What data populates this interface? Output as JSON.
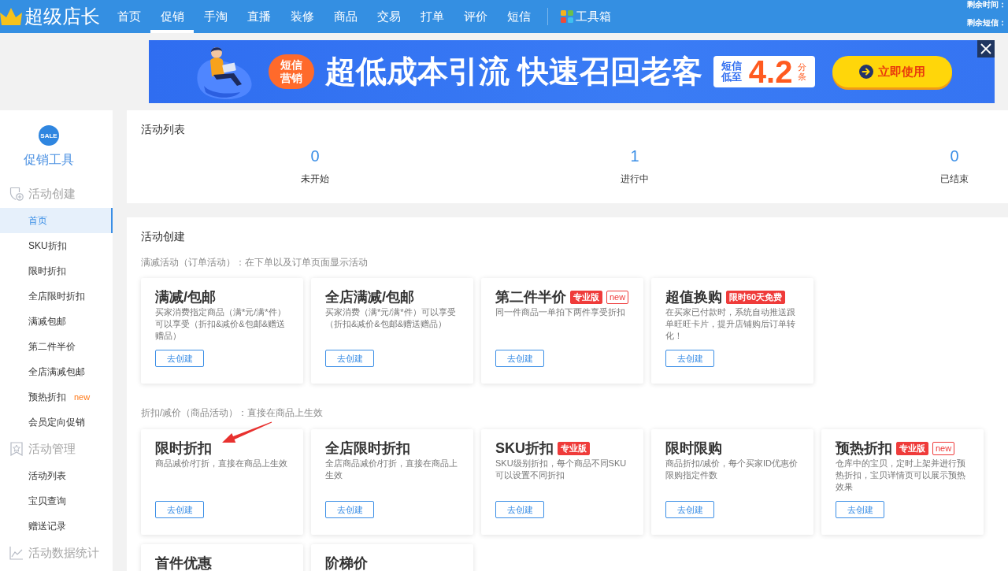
{
  "header": {
    "logo": "超级店长",
    "nav": [
      {
        "label": "首页",
        "selected": false
      },
      {
        "label": "促销",
        "selected": true
      },
      {
        "label": "手淘",
        "selected": false
      },
      {
        "label": "直播",
        "selected": false
      },
      {
        "label": "装修",
        "selected": false
      },
      {
        "label": "商品",
        "selected": false
      },
      {
        "label": "交易",
        "selected": false
      },
      {
        "label": "打单",
        "selected": false
      },
      {
        "label": "评价",
        "selected": false
      },
      {
        "label": "短信",
        "selected": false
      }
    ],
    "toolbox": "工具箱",
    "info": [
      "剩余时间：",
      "剩余短信："
    ]
  },
  "banner": {
    "badge": "短信营销",
    "headline": "超低成本引流 快速召回老客",
    "price_label": "短信低至",
    "price": "4.2",
    "price_unit": "分条",
    "cta": "立即使用"
  },
  "sidebar": {
    "badge": "SALE",
    "title": "促销工具",
    "sections": [
      {
        "kind": "create",
        "title": "活动创建",
        "items": [
          {
            "label": "首页",
            "selected": true
          },
          {
            "label": "SKU折扣",
            "selected": false
          },
          {
            "label": "限时折扣",
            "selected": false
          },
          {
            "label": "全店限时折扣",
            "selected": false
          },
          {
            "label": "满减包邮",
            "selected": false
          },
          {
            "label": "第二件半价",
            "selected": false
          },
          {
            "label": "全店满减包邮",
            "selected": false
          },
          {
            "label": "预热折扣",
            "selected": false,
            "tag": "new"
          },
          {
            "label": "会员定向促销",
            "selected": false
          }
        ]
      },
      {
        "kind": "manage",
        "title": "活动管理",
        "items": [
          {
            "label": "活动列表",
            "selected": false
          },
          {
            "label": "宝贝查询",
            "selected": false
          },
          {
            "label": "赠送记录",
            "selected": false
          }
        ]
      },
      {
        "kind": "stats",
        "title": "活动数据统计"
      }
    ]
  },
  "activity_list": {
    "title": "活动列表",
    "stats": [
      {
        "value": "0",
        "label": "未开始"
      },
      {
        "value": "1",
        "label": "进行中"
      },
      {
        "value": "0",
        "label": "已结束"
      }
    ]
  },
  "activity_create": {
    "title": "活动创建",
    "groups": [
      {
        "caption": "满减活动（订单活动）：在下单以及订单页面显示活动",
        "cards": [
          {
            "title": "满减/包邮",
            "description": "买家消费指定商品（满*元/满*件）可以享受（折扣&减价&包邮&赠送赠品）",
            "button": "去创建"
          },
          {
            "title": "全店满减/包邮",
            "description": "买家消费（满*元/满*件）可以享受（折扣&减价&包邮&赠送赠品）",
            "button": "去创建"
          },
          {
            "title": "第二件半价",
            "tags": [
              {
                "kind": "filled",
                "text": "专业版"
              },
              {
                "kind": "outlined",
                "text": "new"
              }
            ],
            "description": "同一件商品一单拍下两件享受折扣",
            "button": "去创建"
          },
          {
            "title": "超值换购",
            "tags": [
              {
                "kind": "filled",
                "text": "限时60天免费"
              }
            ],
            "description": "在买家已付款时，系统自动推送跟单旺旺卡片，提升店铺购后订单转化！",
            "button": "去创建"
          }
        ]
      },
      {
        "caption": "折扣/减价（商品活动）：直接在商品上生效",
        "cards": [
          {
            "title": "限时折扣",
            "description": "商品减价/打折，直接在商品上生效",
            "button": "去创建"
          },
          {
            "title": "全店限时折扣",
            "description": "全店商品减价/打折，直接在商品上生效",
            "button": "去创建"
          },
          {
            "title": "SKU折扣",
            "tags": [
              {
                "kind": "filled",
                "text": "专业版"
              }
            ],
            "description": "SKU级别折扣，每个商品不同SKU可以设置不同折扣",
            "button": "去创建"
          },
          {
            "title": "限时限购",
            "description": "商品折扣/减价，每个买家ID优惠价限购指定件数",
            "button": "去创建"
          },
          {
            "title": "预热折扣",
            "tags": [
              {
                "kind": "filled",
                "text": "专业版"
              },
              {
                "kind": "outlined",
                "text": "new"
              }
            ],
            "description": "仓库中的宝贝，定时上架并进行预热折扣，宝贝详情页可以展示预热效果",
            "button": "去创建"
          },
          {
            "title": "首件优惠"
          },
          {
            "title": "阶梯价"
          }
        ]
      }
    ]
  }
}
